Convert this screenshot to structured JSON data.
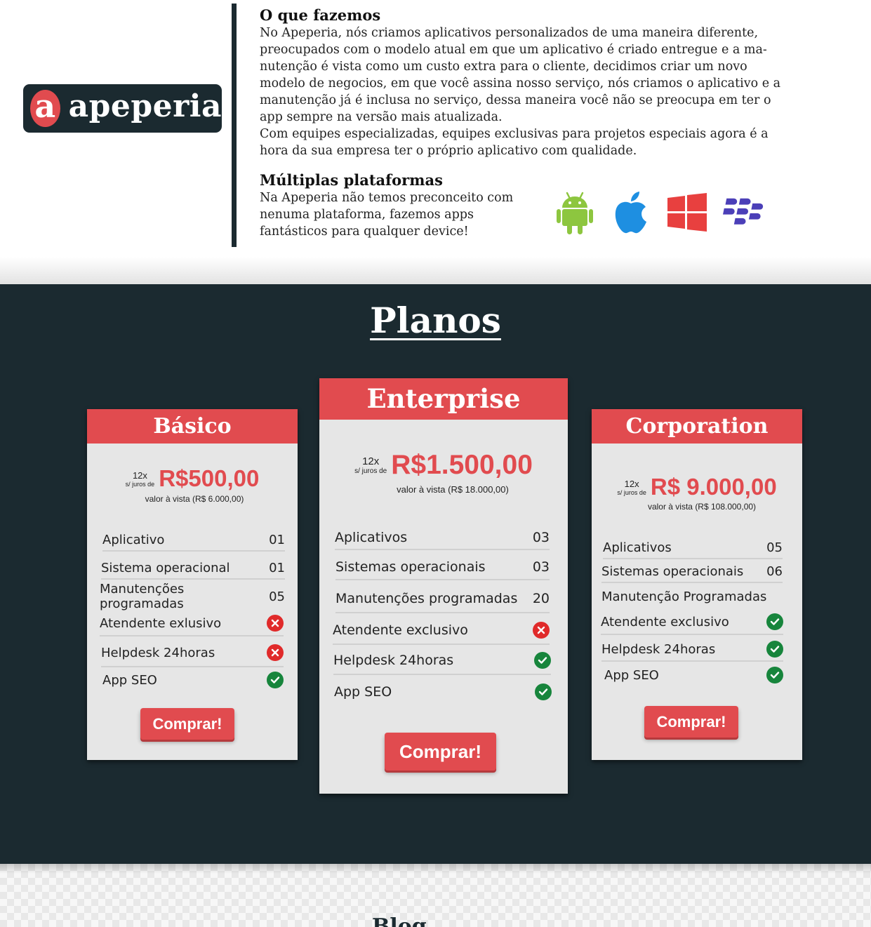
{
  "brand": {
    "mark": "a",
    "name": "apeperia"
  },
  "about": {
    "title": "O que fazemos",
    "text": "No Apeperia, nós criamos aplicativos personalizados de uma maneira diferente,\npreocupados com o modelo atual em que um aplicativo é criado entregue e a ma-\nnutenção é vista como um custo extra para o cliente, decidimos criar um novo\nmodelo de negocios, em que você assina nosso serviço, nós criamos o aplicativo e a\nmanutenção já é inclusa no serviço, dessa maneira você não se preocupa em ter o\napp sempre na versão mais atualizada.\nCom equipes especializadas, equipes exclusivas para projetos especiais agora é a\nhora da sua empresa ter o próprio aplicativo com qualidade."
  },
  "platforms": {
    "title": "Múltiplas plataformas",
    "text": "Na Apeperia não temos preconceito com\nnenuma plataforma, fazemos apps\nfantásticos para qualquer device!",
    "icons": [
      "android-icon",
      "apple-icon",
      "windows-icon",
      "blackberry-icon"
    ],
    "colors": {
      "android": "#8dc63f",
      "apple": "#1e8fe1",
      "windows": "#e8403f",
      "blackberry": "#4b3fb8"
    }
  },
  "plans": {
    "title": "Planos",
    "installments": "12x",
    "interest": "s/ juros de",
    "buy_label": "Comprar!",
    "basic": {
      "name": "Básico",
      "price": "R$500,00",
      "cash": "valor à vista (R$ 6.000,00)",
      "features": [
        {
          "label": "Aplicativo",
          "value": "01"
        },
        {
          "label": "Sistema operacional",
          "value": "01"
        },
        {
          "label": "Manutenções programadas",
          "value": "05"
        },
        {
          "label": "Atendente exlusivo",
          "status": "no"
        },
        {
          "label": "Helpdesk 24horas",
          "status": "no"
        },
        {
          "label": "App SEO",
          "status": "yes"
        }
      ]
    },
    "enterprise": {
      "name": "Enterprise",
      "price": "R$1.500,00",
      "cash": "valor à vista (R$ 18.000,00)",
      "features": [
        {
          "label": "Aplicativos",
          "value": "03"
        },
        {
          "label": "Sistemas operacionais",
          "value": "03"
        },
        {
          "label": "Manutenções programadas",
          "value": "20"
        },
        {
          "label": "Atendente exclusivo",
          "status": "no"
        },
        {
          "label": "Helpdesk 24horas",
          "status": "yes"
        },
        {
          "label": "App SEO",
          "status": "yes"
        }
      ]
    },
    "corporation": {
      "name": "Corporation",
      "price": "R$ 9.000,00",
      "cash": "valor à vista (R$ 108.000,00)",
      "features": [
        {
          "label": "Aplicativos",
          "value": "05"
        },
        {
          "label": "Sistemas operacionais",
          "value": "06"
        },
        {
          "label": "Manutenção Programadas"
        },
        {
          "label": "Atendente exclusivo",
          "status": "yes"
        },
        {
          "label": "Helpdesk 24horas",
          "status": "yes"
        },
        {
          "label": "App SEO",
          "status": "yes"
        }
      ]
    }
  },
  "blog": {
    "title": "Blog"
  },
  "colors": {
    "accent": "#e14b4f",
    "dark": "#1b2a30",
    "yes": "#17853c",
    "no": "#e02a2a"
  }
}
